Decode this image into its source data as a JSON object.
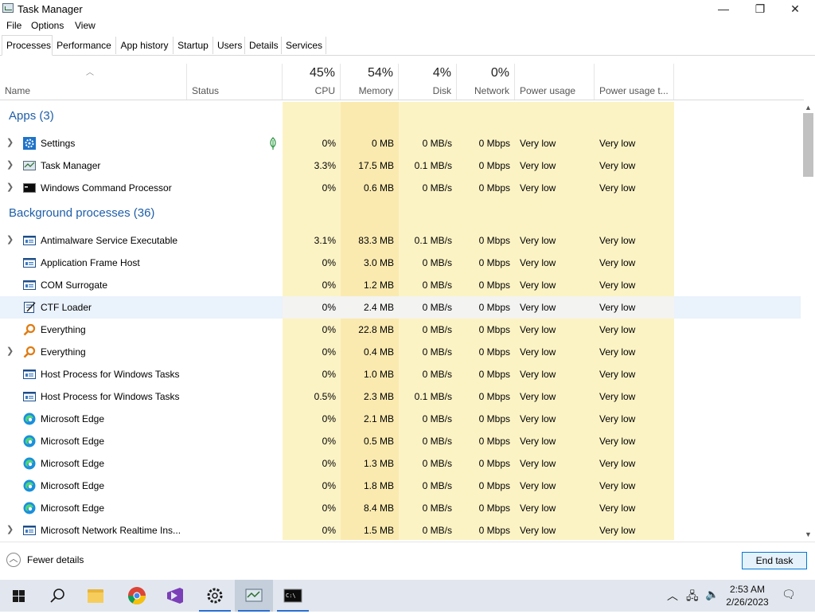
{
  "window": {
    "title": "Task Manager",
    "minimize": "—",
    "restore": "❐",
    "close": "✕"
  },
  "menu": [
    "File",
    "Options",
    "View"
  ],
  "tabs": [
    "Processes",
    "Performance",
    "App history",
    "Startup",
    "Users",
    "Details",
    "Services"
  ],
  "header": {
    "name": "Name",
    "status": "Status",
    "cpu_pct": "45%",
    "cpu": "CPU",
    "mem_pct": "54%",
    "mem": "Memory",
    "disk_pct": "4%",
    "disk": "Disk",
    "net_pct": "0%",
    "net": "Network",
    "power": "Power usage",
    "power_trend": "Power usage t..."
  },
  "groups": {
    "apps": "Apps (3)",
    "background": "Background processes (36)"
  },
  "apps": [
    {
      "name": "Settings",
      "cpu": "0%",
      "mem": "0 MB",
      "disk": "0 MB/s",
      "net": "0 Mbps",
      "power": "Very low",
      "power_trend": "Very low",
      "icon": "settings-gear-icon",
      "expand": true
    },
    {
      "name": "Task Manager",
      "cpu": "3.3%",
      "mem": "17.5 MB",
      "disk": "0.1 MB/s",
      "net": "0 Mbps",
      "power": "Very low",
      "power_trend": "Very low",
      "icon": "task-manager-icon",
      "expand": true
    },
    {
      "name": "Windows Command Processor",
      "cpu": "0%",
      "mem": "0.6 MB",
      "disk": "0 MB/s",
      "net": "0 Mbps",
      "power": "Very low",
      "power_trend": "Very low",
      "icon": "cmd-icon",
      "expand": true
    }
  ],
  "background": [
    {
      "name": "Antimalware Service Executable",
      "cpu": "3.1%",
      "mem": "83.3 MB",
      "disk": "0.1 MB/s",
      "net": "0 Mbps",
      "power": "Very low",
      "power_trend": "Very low",
      "icon": "service-window-icon",
      "expand": true
    },
    {
      "name": "Application Frame Host",
      "cpu": "0%",
      "mem": "3.0 MB",
      "disk": "0 MB/s",
      "net": "0 Mbps",
      "power": "Very low",
      "power_trend": "Very low",
      "icon": "service-window-icon",
      "expand": false
    },
    {
      "name": "COM Surrogate",
      "cpu": "0%",
      "mem": "1.2 MB",
      "disk": "0 MB/s",
      "net": "0 Mbps",
      "power": "Very low",
      "power_trend": "Very low",
      "icon": "service-window-icon",
      "expand": false
    },
    {
      "name": "CTF Loader",
      "cpu": "0%",
      "mem": "2.4 MB",
      "disk": "0 MB/s",
      "net": "0 Mbps",
      "power": "Very low",
      "power_trend": "Very low",
      "icon": "ctf-loader-icon",
      "expand": false,
      "selected": true
    },
    {
      "name": "Everything",
      "cpu": "0%",
      "mem": "22.8 MB",
      "disk": "0 MB/s",
      "net": "0 Mbps",
      "power": "Very low",
      "power_trend": "Very low",
      "icon": "magnifier-icon",
      "expand": false
    },
    {
      "name": "Everything",
      "cpu": "0%",
      "mem": "0.4 MB",
      "disk": "0 MB/s",
      "net": "0 Mbps",
      "power": "Very low",
      "power_trend": "Very low",
      "icon": "magnifier-icon",
      "expand": true
    },
    {
      "name": "Host Process for Windows Tasks",
      "cpu": "0%",
      "mem": "1.0 MB",
      "disk": "0 MB/s",
      "net": "0 Mbps",
      "power": "Very low",
      "power_trend": "Very low",
      "icon": "service-window-icon",
      "expand": false
    },
    {
      "name": "Host Process for Windows Tasks",
      "cpu": "0.5%",
      "mem": "2.3 MB",
      "disk": "0.1 MB/s",
      "net": "0 Mbps",
      "power": "Very low",
      "power_trend": "Very low",
      "icon": "service-window-icon",
      "expand": false
    },
    {
      "name": "Microsoft Edge",
      "cpu": "0%",
      "mem": "2.1 MB",
      "disk": "0 MB/s",
      "net": "0 Mbps",
      "power": "Very low",
      "power_trend": "Very low",
      "icon": "edge-icon",
      "expand": false
    },
    {
      "name": "Microsoft Edge",
      "cpu": "0%",
      "mem": "0.5 MB",
      "disk": "0 MB/s",
      "net": "0 Mbps",
      "power": "Very low",
      "power_trend": "Very low",
      "icon": "edge-icon",
      "expand": false
    },
    {
      "name": "Microsoft Edge",
      "cpu": "0%",
      "mem": "1.3 MB",
      "disk": "0 MB/s",
      "net": "0 Mbps",
      "power": "Very low",
      "power_trend": "Very low",
      "icon": "edge-icon",
      "expand": false
    },
    {
      "name": "Microsoft Edge",
      "cpu": "0%",
      "mem": "1.8 MB",
      "disk": "0 MB/s",
      "net": "0 Mbps",
      "power": "Very low",
      "power_trend": "Very low",
      "icon": "edge-icon",
      "expand": false
    },
    {
      "name": "Microsoft Edge",
      "cpu": "0%",
      "mem": "8.4 MB",
      "disk": "0 MB/s",
      "net": "0 Mbps",
      "power": "Very low",
      "power_trend": "Very low",
      "icon": "edge-icon",
      "expand": false
    },
    {
      "name": "Microsoft Network Realtime Ins...",
      "cpu": "0%",
      "mem": "1.5 MB",
      "disk": "0 MB/s",
      "net": "0 Mbps",
      "power": "Very low",
      "power_trend": "Very low",
      "icon": "service-window-icon",
      "expand": true
    }
  ],
  "footer": {
    "fewer_details": "Fewer details",
    "end_task": "End task"
  },
  "taskbar": {
    "time": "2:53 AM",
    "date": "2/26/2023"
  },
  "colors": {
    "cpu_heat": "#fcf3c5",
    "mem_heat": "#fbeab0",
    "group_title": "#1e5ea8",
    "accent": "#0078d7"
  }
}
